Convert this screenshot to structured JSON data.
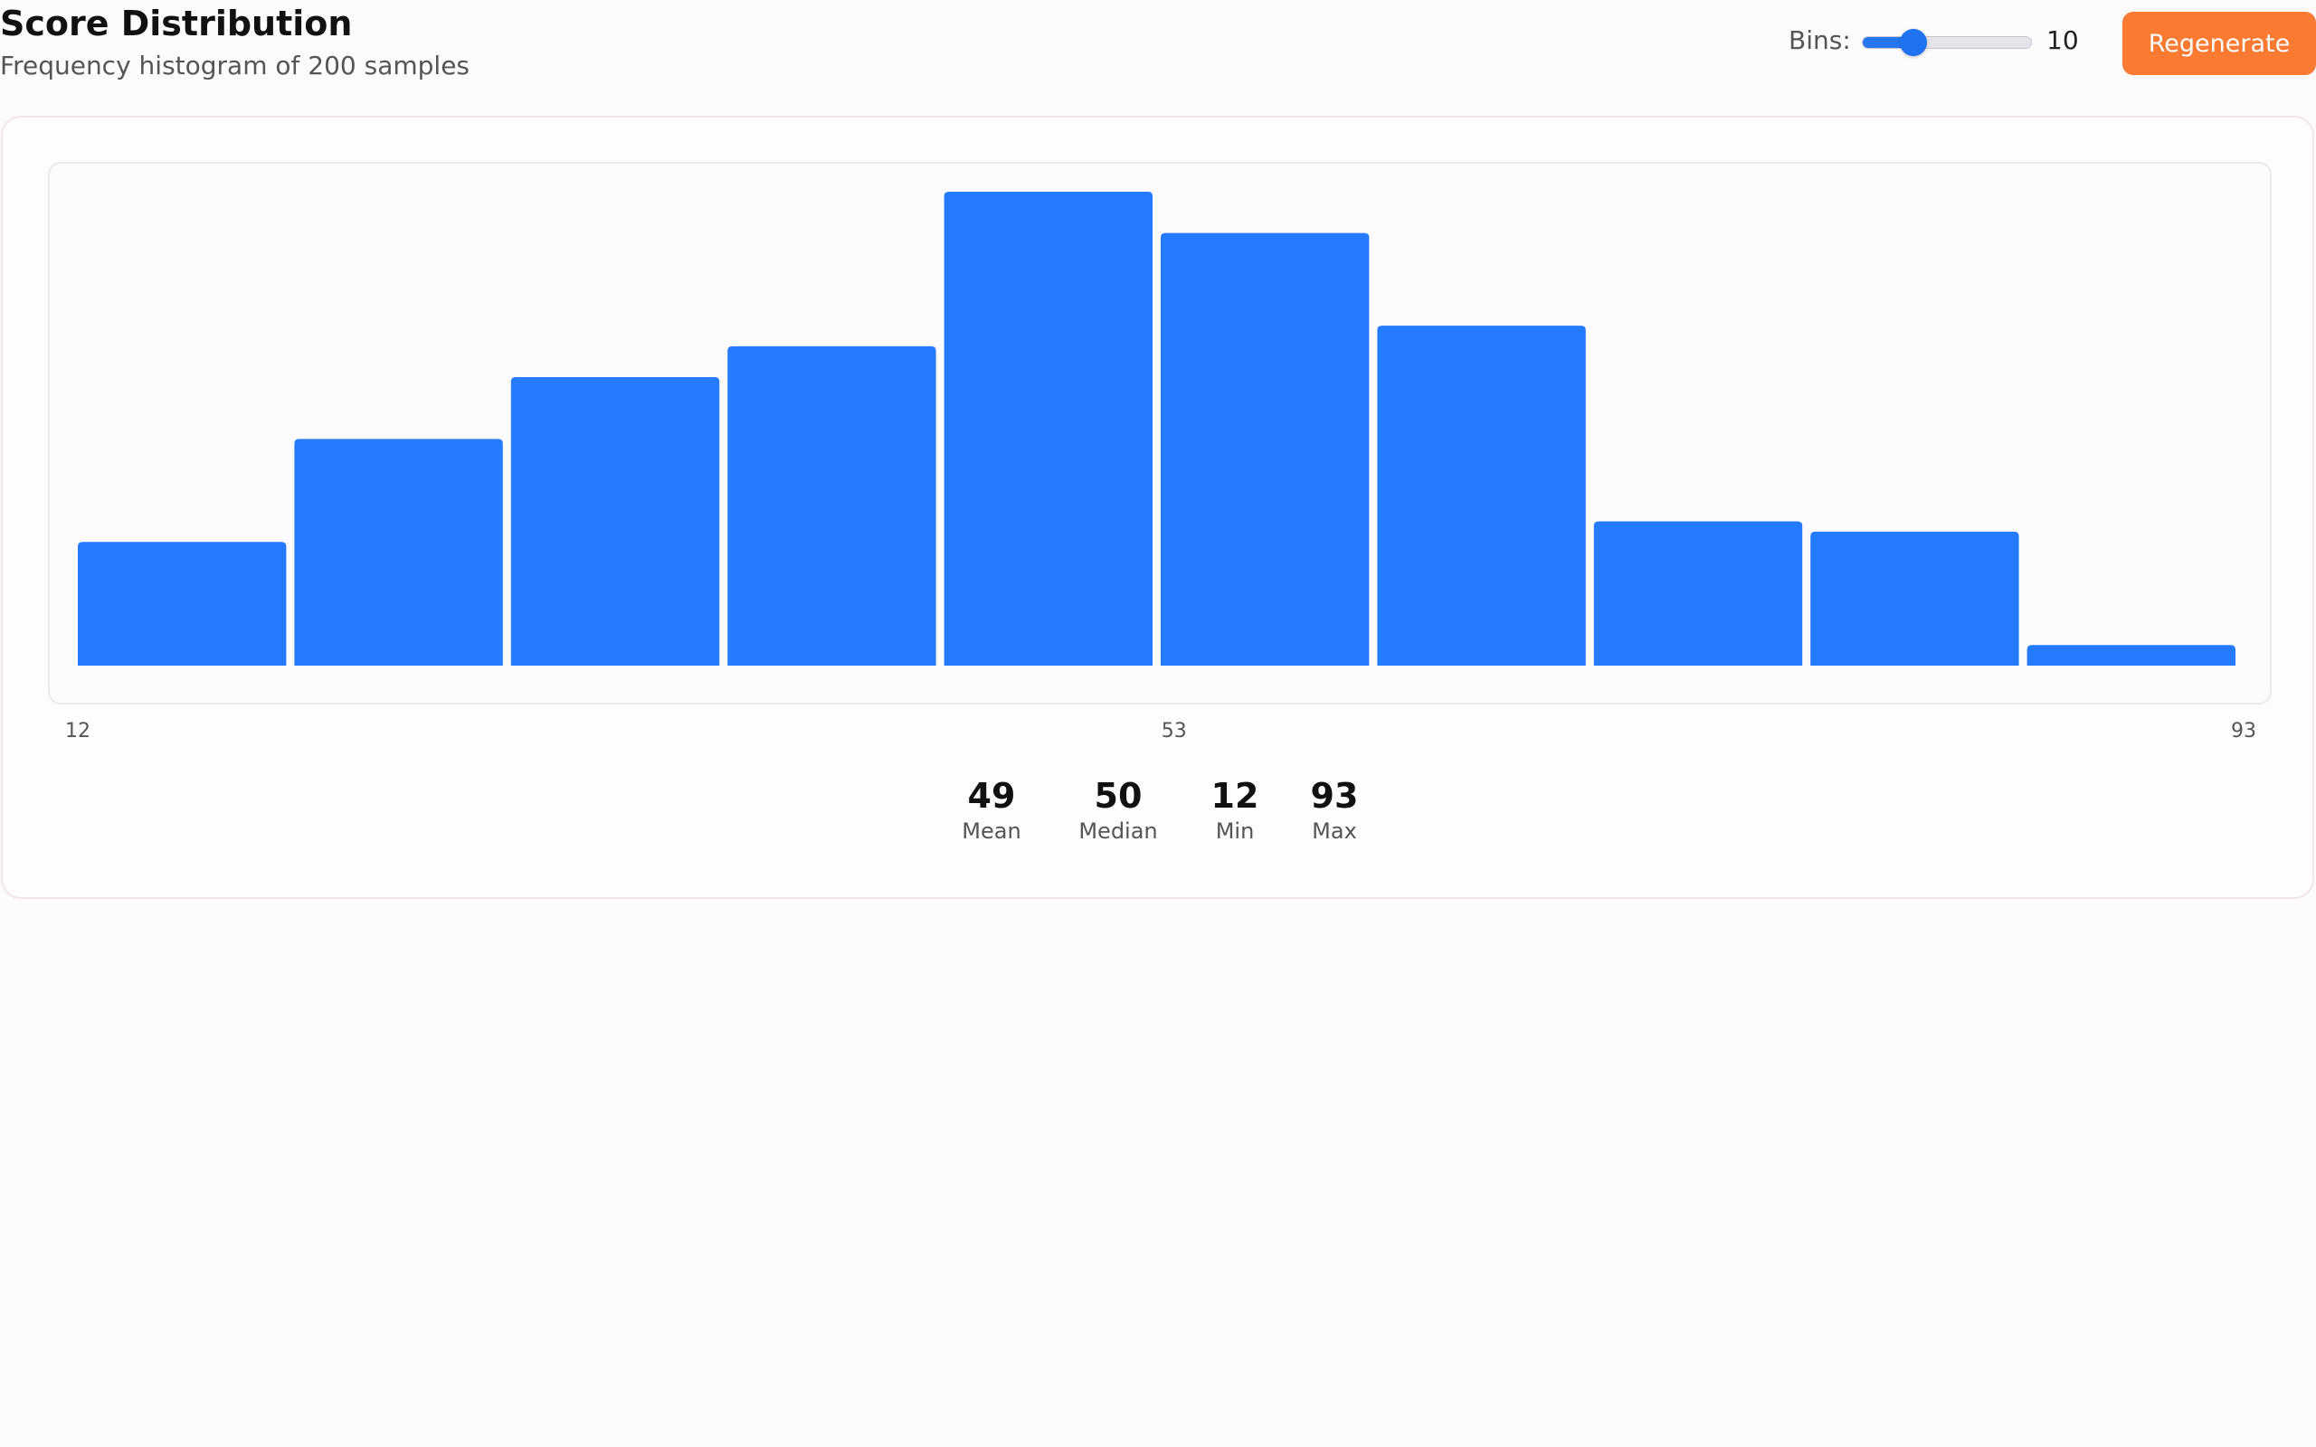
{
  "header": {
    "title": "Score Distribution",
    "subtitle": "Frequency histogram of 200 samples"
  },
  "controls": {
    "bins_label": "Bins:",
    "bins_value": "10",
    "bins_slider_fraction": 0.3,
    "regenerate_label": "Regenerate"
  },
  "colors": {
    "bar": "#257bff",
    "accent_button": "#fb7a32",
    "slider": "#1f73f0"
  },
  "chart_data": {
    "type": "bar",
    "bin_edges": [
      12,
      20.1,
      28.2,
      36.3,
      44.4,
      52.5,
      60.6,
      68.7,
      76.8,
      84.9,
      93
    ],
    "values": [
      12,
      22,
      28,
      31,
      46,
      42,
      33,
      14,
      13,
      2
    ],
    "ylim": [
      0,
      46
    ],
    "xlabel": "",
    "ylabel": "",
    "x_ticks": [
      "12",
      "53",
      "93"
    ],
    "grid": false
  },
  "stats": [
    {
      "value": "49",
      "label": "Mean"
    },
    {
      "value": "50",
      "label": "Median"
    },
    {
      "value": "12",
      "label": "Min"
    },
    {
      "value": "93",
      "label": "Max"
    }
  ]
}
